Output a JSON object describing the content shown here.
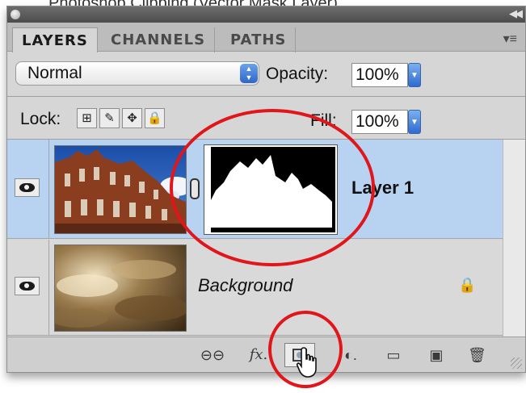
{
  "top_crop_text": "Photoshop Clipping (Vector Mask Layer)",
  "panel": {
    "tabs": [
      {
        "label": "LAYERS",
        "active": true
      },
      {
        "label": "CHANNELS",
        "active": false
      },
      {
        "label": "PATHS",
        "active": false
      }
    ],
    "menu_icon": "panel-menu-icon"
  },
  "blend_mode": {
    "value": "Normal"
  },
  "opacity": {
    "label": "Opacity:",
    "value": "100%"
  },
  "lock": {
    "label": "Lock:"
  },
  "fill": {
    "label": "Fill:",
    "value": "100%"
  },
  "layers": [
    {
      "name": "Layer 1",
      "selected": true,
      "visible": true,
      "has_mask": true
    },
    {
      "name": "Background",
      "selected": false,
      "visible": true,
      "locked": true
    }
  ],
  "footer_icons": [
    "link-icon",
    "fx-icon",
    "add-mask-icon",
    "adjustment-icon",
    "folder-icon",
    "new-layer-icon",
    "trash-icon"
  ],
  "colors": {
    "selection": "#b8d2f2",
    "annotation": "#e0161b",
    "accent": "#2f6ad0"
  }
}
